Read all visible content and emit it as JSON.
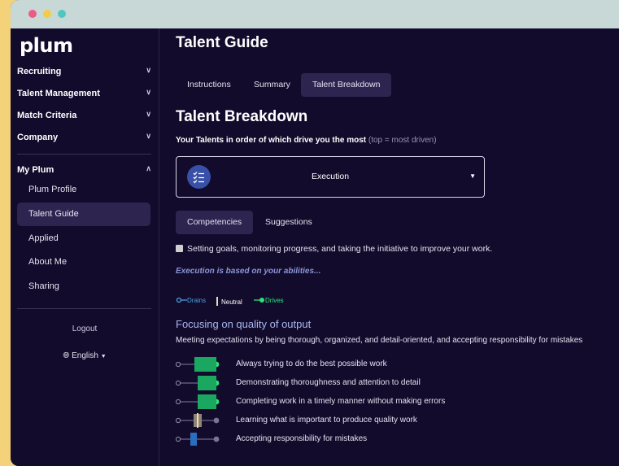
{
  "window": {
    "traffic_lights": [
      "#e85c86",
      "#f2cc44",
      "#4cc8c0"
    ]
  },
  "sidebar": {
    "logo": "plum",
    "sections": [
      {
        "label": "Recruiting",
        "icon": "chevron-down-icon"
      },
      {
        "label": "Talent Management",
        "icon": "chevron-down-icon"
      },
      {
        "label": "Match Criteria",
        "icon": "chevron-down-icon"
      },
      {
        "label": "Company",
        "icon": "chevron-down-icon"
      }
    ],
    "my_plum": {
      "label": "My Plum",
      "icon": "chevron-up-icon"
    },
    "items": [
      {
        "label": "Plum Profile",
        "active": false
      },
      {
        "label": "Talent Guide",
        "active": true
      },
      {
        "label": "Applied",
        "active": false
      },
      {
        "label": "About Me",
        "active": false
      },
      {
        "label": "Sharing",
        "active": false
      }
    ],
    "logout": "Logout",
    "language": "English"
  },
  "main": {
    "page_title": "Talent Guide",
    "tabs": [
      {
        "label": "Instructions",
        "active": false
      },
      {
        "label": "Summary",
        "active": false
      },
      {
        "label": "Talent Breakdown",
        "active": true
      }
    ],
    "section_title": "Talent Breakdown",
    "subtitle_bold": "Your Talents in order of which drive you the most",
    "subtitle_hint": "(top = most driven)",
    "select": {
      "value": "Execution",
      "icon": "checklist-icon"
    },
    "subtabs": [
      {
        "label": "Competencies",
        "active": true
      },
      {
        "label": "Suggestions",
        "active": false
      }
    ],
    "description": "Setting goals, monitoring progress, and taking the initiative to improve your work.",
    "note": "Execution is based on your abilities...",
    "legend": [
      {
        "label": "Drains",
        "color": "#4a9fe0"
      },
      {
        "label": "Neutral",
        "color": "#e8dcb0"
      },
      {
        "label": "Drives",
        "color": "#2de07a"
      }
    ],
    "focus_title": "Focusing on quality of output",
    "focus_desc": "Meeting expectations by being thorough, organized, and detail-oriented, and accepting responsibility for mistakes",
    "competencies": [
      {
        "label": "Always trying to do the best possible work",
        "level": "drives",
        "strength": 0.75
      },
      {
        "label": "Demonstrating thoroughness and attention to detail",
        "level": "drives",
        "strength": 0.65
      },
      {
        "label": "Completing work in a timely manner without making errors",
        "level": "drives",
        "strength": 0.65
      },
      {
        "label": "Learning what is important to produce quality work",
        "level": "neutral",
        "strength": 0.5
      },
      {
        "label": "Accepting responsibility for mistakes",
        "level": "drains",
        "strength": 0.35
      }
    ]
  }
}
